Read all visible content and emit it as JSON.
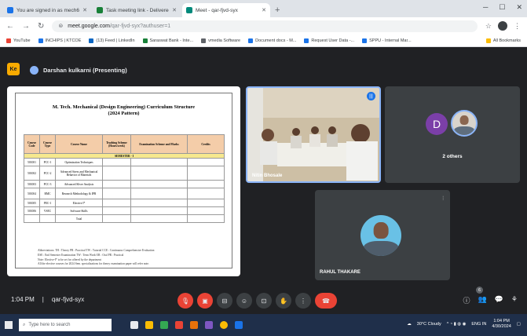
{
  "browser": {
    "tabs": [
      {
        "title": "You are signed in as mech61",
        "color": "#1a73e8"
      },
      {
        "title": "Task meeting link - Delivered",
        "color": "#188038"
      },
      {
        "title": "Meet - qar-fjvd-syx",
        "color": "#00897b",
        "active": true
      }
    ],
    "url": "meet.google.com",
    "url_rest": "/qar-fjvd-syx?authuser=1",
    "bookmarks": [
      {
        "label": "YouTube",
        "color": "#ea4335"
      },
      {
        "label": "INCHIPS | KTCOE",
        "color": "#1a73e8"
      },
      {
        "label": "(13) Feed | LinkedIn",
        "color": "#0a66c2"
      },
      {
        "label": "Saraswat Bank - Inte...",
        "color": "#188038"
      },
      {
        "label": "vmedia Software",
        "color": "#5f6368"
      },
      {
        "label": "Document docs - M...",
        "color": "#1a73e8"
      },
      {
        "label": "Request User Data -...",
        "color": "#1a73e8"
      },
      {
        "label": "SPPU - Internal Mar...",
        "color": "#1a73e8"
      }
    ],
    "all_bookmarks": "All Bookmarks"
  },
  "meet": {
    "badge": "Ke",
    "presenter": "Darshan kulkarni (Presenting)",
    "camera_name": "Nitin Bhosale",
    "others_label": "2 others",
    "others_initial": "D",
    "rahul_name": "RAHUL THAKARE",
    "time": "1:04 PM",
    "meeting_code": "qar-fjvd-syx",
    "participants_count": "6"
  },
  "document": {
    "title": "M. Tech. Mechanical (Design Engineering) Curriculum Structure",
    "subtitle": "(2024 Pattern)",
    "headers": [
      "Course Code",
      "Course Type",
      "Course Name",
      "Teaching Scheme (Hours/week)",
      "Examination Scheme and Marks",
      "Credits"
    ],
    "semester": "SEMESTER - I",
    "rows": [
      {
        "code": "501001",
        "type": "PCC-1",
        "name": "Optimization Techniques"
      },
      {
        "code": "501002",
        "type": "PCC-2",
        "name": "Advanced Stress and Mechanical Behavior of Materials"
      },
      {
        "code": "501003",
        "type": "PCC-3",
        "name": "Advanced Sliver Analysis"
      },
      {
        "code": "501004",
        "type": "RMC",
        "name": "Research Methodology & IPR"
      },
      {
        "code": "501005",
        "type": "PEC-1",
        "name": "Elective I*"
      },
      {
        "code": "501006",
        "type": "VSEC",
        "name": "Software Skills"
      },
      {
        "code": "",
        "type": "",
        "name": "Total"
      }
    ],
    "notes": [
      "Abbreviations: TH : Theory     PR : Practical     TW : Tutorial     CCE : Continuous Comprehensive Evaluation",
      "ESE : End Semester Examination     TW : Term Work     OR : Oral     PR : Practical",
      "Note: Elective-I* to be set for offered by the department",
      "All the elective courses for 2024 Sem. specializations for theory examination paper will refer note."
    ]
  },
  "taskbar": {
    "search_placeholder": "Type here to search",
    "weather": "30°C Cloudy",
    "lang": "ENG IN",
    "clock_time": "1:04 PM",
    "clock_date": "4/30/2024"
  }
}
